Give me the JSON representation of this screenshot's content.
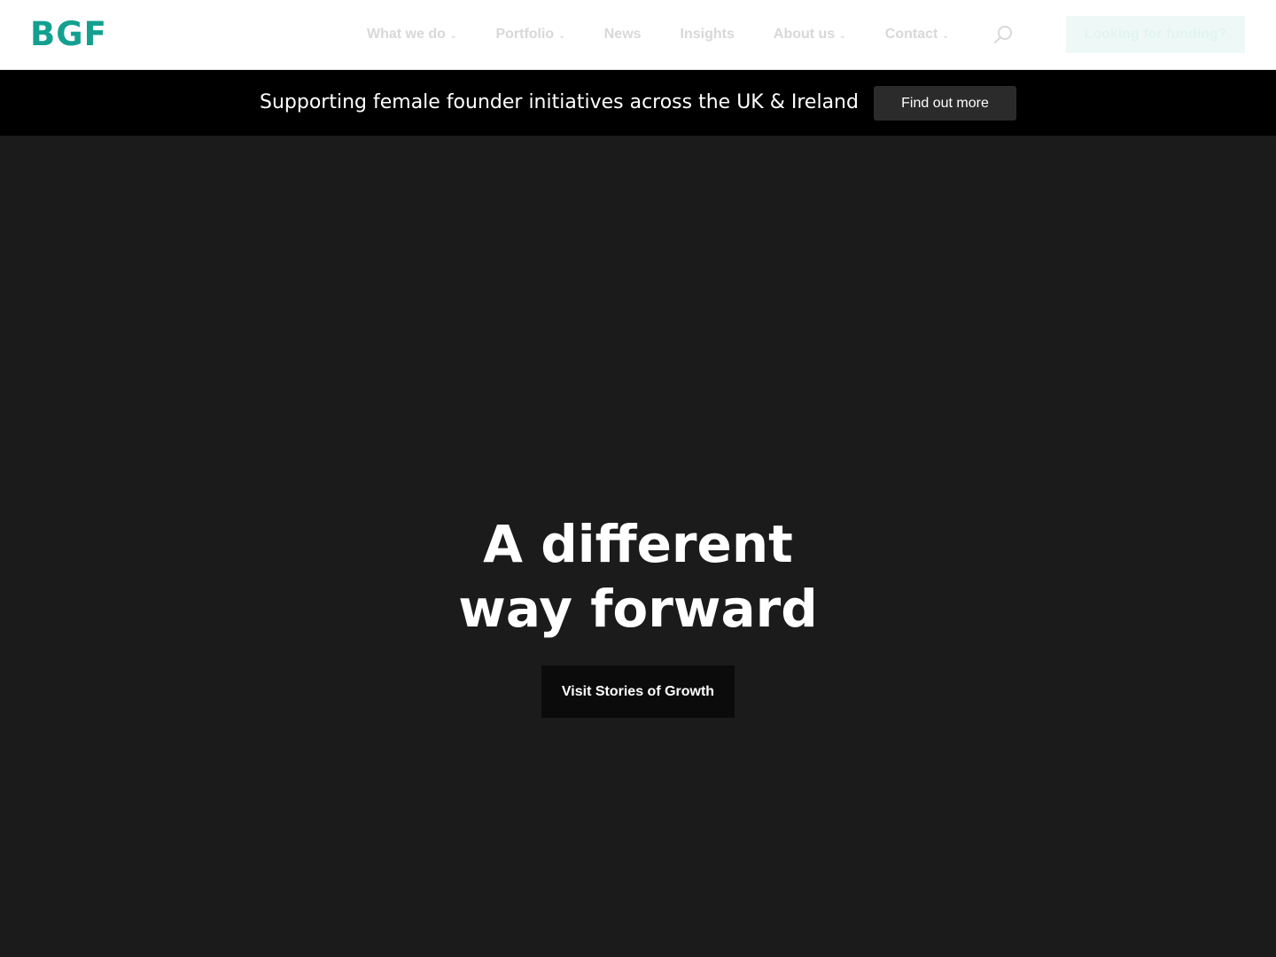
{
  "header": {
    "logo_text": "BGF",
    "nav": [
      {
        "label": "What we do",
        "has_dropdown": true
      },
      {
        "label": "Portfolio",
        "has_dropdown": true
      },
      {
        "label": "News",
        "has_dropdown": false
      },
      {
        "label": "Insights",
        "has_dropdown": false
      },
      {
        "label": "About us",
        "has_dropdown": true
      },
      {
        "label": "Contact",
        "has_dropdown": true
      }
    ],
    "search_icon": "search-icon",
    "cta_label": "Looking for funding?"
  },
  "banner": {
    "text": "Supporting female founder initiatives across the UK & Ireland",
    "button_label": "Find out more"
  },
  "hero": {
    "title_line1": "A different",
    "title_line2": "way forward",
    "button_label": "Visit Stories of Growth"
  },
  "colors": {
    "brand": "#14a090",
    "banner_bg": "#000000",
    "hero_bg": "#1b1b1b"
  }
}
